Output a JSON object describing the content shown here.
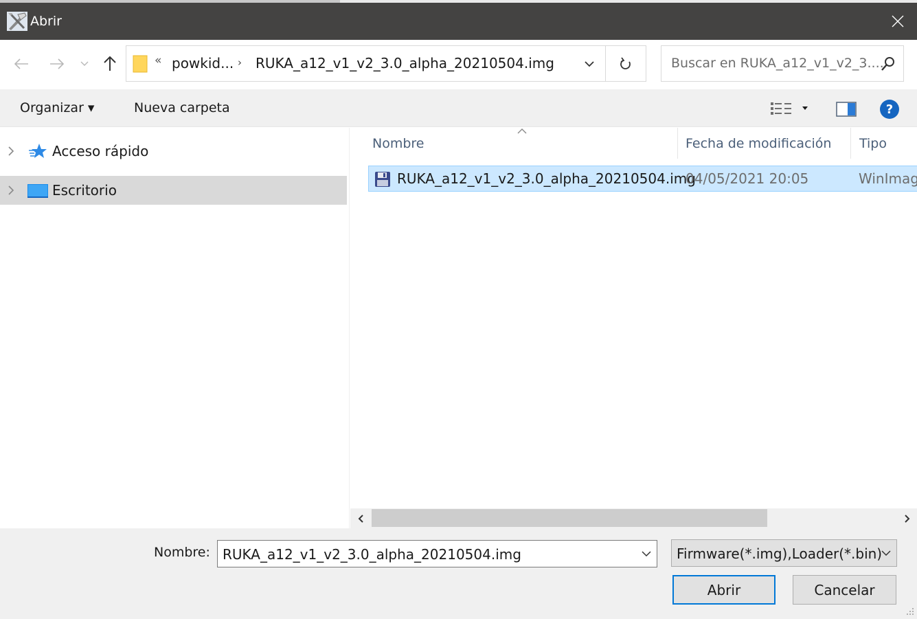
{
  "window": {
    "title": "Abrir",
    "app_icon": "tool-hammer-icon",
    "close_icon": "close-icon"
  },
  "navigation": {
    "back_icon": "arrow-left-icon",
    "forward_icon": "arrow-right-icon",
    "recent_icon": "chevron-down-icon",
    "up_icon": "arrow-up-icon"
  },
  "address": {
    "overflow_chevron": "«",
    "crumb1": "powkid...",
    "separator": "›",
    "crumb2": "RUKA_a12_v1_v2_3.0_alpha_20210504.img",
    "refresh_icon": "refresh-icon"
  },
  "search": {
    "placeholder": "Buscar en RUKA_a12_v1_v2_3....",
    "icon": "search-icon"
  },
  "toolbar": {
    "organize_label": "Organizar ▾",
    "new_folder_label": "Nueva carpeta",
    "view_icon": "view-options-icon",
    "preview_pane_icon": "preview-pane-icon",
    "help_icon": "help-icon",
    "help_glyph": "?"
  },
  "nav_pane": {
    "items": [
      {
        "label": "Acceso rápido",
        "icon": "quick-access-star-icon",
        "selected": false
      },
      {
        "label": "Escritorio",
        "icon": "desktop-icon",
        "selected": true
      }
    ]
  },
  "file_list": {
    "columns": [
      "Nombre",
      "Fecha de modificación",
      "Tipo"
    ],
    "sorted_by": "Nombre",
    "rows": [
      {
        "name": "RUKA_a12_v1_v2_3.0_alpha_20210504.img",
        "date": "04/05/2021 20:05",
        "type": "WinImag",
        "icon": "floppy-disk-icon",
        "selected": true
      }
    ]
  },
  "footer": {
    "filename_label": "Nombre:",
    "filename_value": "RUKA_a12_v1_v2_3.0_alpha_20210504.img",
    "filter_value": "Firmware(*.img),Loader(*.bin)",
    "open_button": "Abrir",
    "cancel_button": "Cancelar"
  },
  "colors": {
    "titlebar": "#444342",
    "selection_bg": "#cce8ff",
    "selection_border": "#99d1ff",
    "accent": "#0078d7",
    "nav_selected": "#d9d9d9",
    "column_header_text": "#4c607a"
  }
}
